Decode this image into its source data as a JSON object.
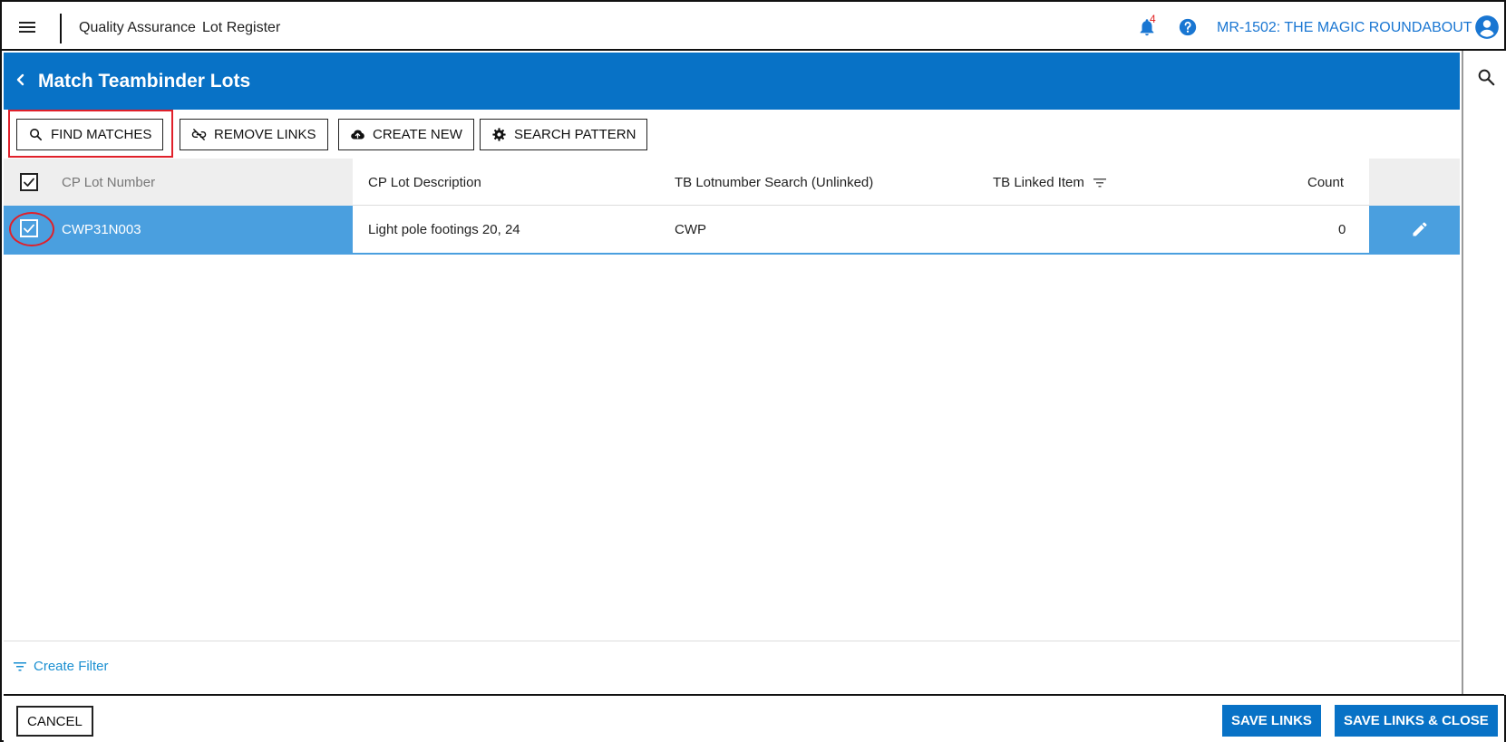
{
  "topbar": {
    "breadcrumb_module": "Quality Assurance",
    "breadcrumb_page": "Lot Register",
    "notification_count": "4",
    "project_name": "MR-1502: THE MAGIC ROUNDABOUT"
  },
  "header": {
    "title": "Match Teambinder Lots"
  },
  "toolbar": {
    "find_matches": "FIND MATCHES",
    "remove_links": "REMOVE LINKS",
    "create_new": "CREATE NEW",
    "search_pattern": "SEARCH PATTERN"
  },
  "table": {
    "columns": {
      "cp_lot_number": "CP Lot Number",
      "cp_lot_description": "CP Lot Description",
      "tb_lotnumber_search": "TB Lotnumber Search (Unlinked)",
      "tb_linked_item": "TB Linked Item",
      "count": "Count"
    },
    "rows": [
      {
        "selected": true,
        "cp_lot_number": "CWP31N003",
        "cp_lot_description": "Light pole footings 20, 24",
        "tb_lotnumber_search": "CWP",
        "tb_linked_item": "",
        "count": "0"
      }
    ]
  },
  "footer": {
    "create_filter": "Create Filter",
    "cancel": "CANCEL",
    "save_links": "SAVE LINKS",
    "save_links_close": "SAVE LINKS & CLOSE"
  },
  "colors": {
    "primary": "#0872c6",
    "row_selected": "#4a9fdf",
    "link": "#1976d2",
    "annotation": "#e0202a"
  }
}
